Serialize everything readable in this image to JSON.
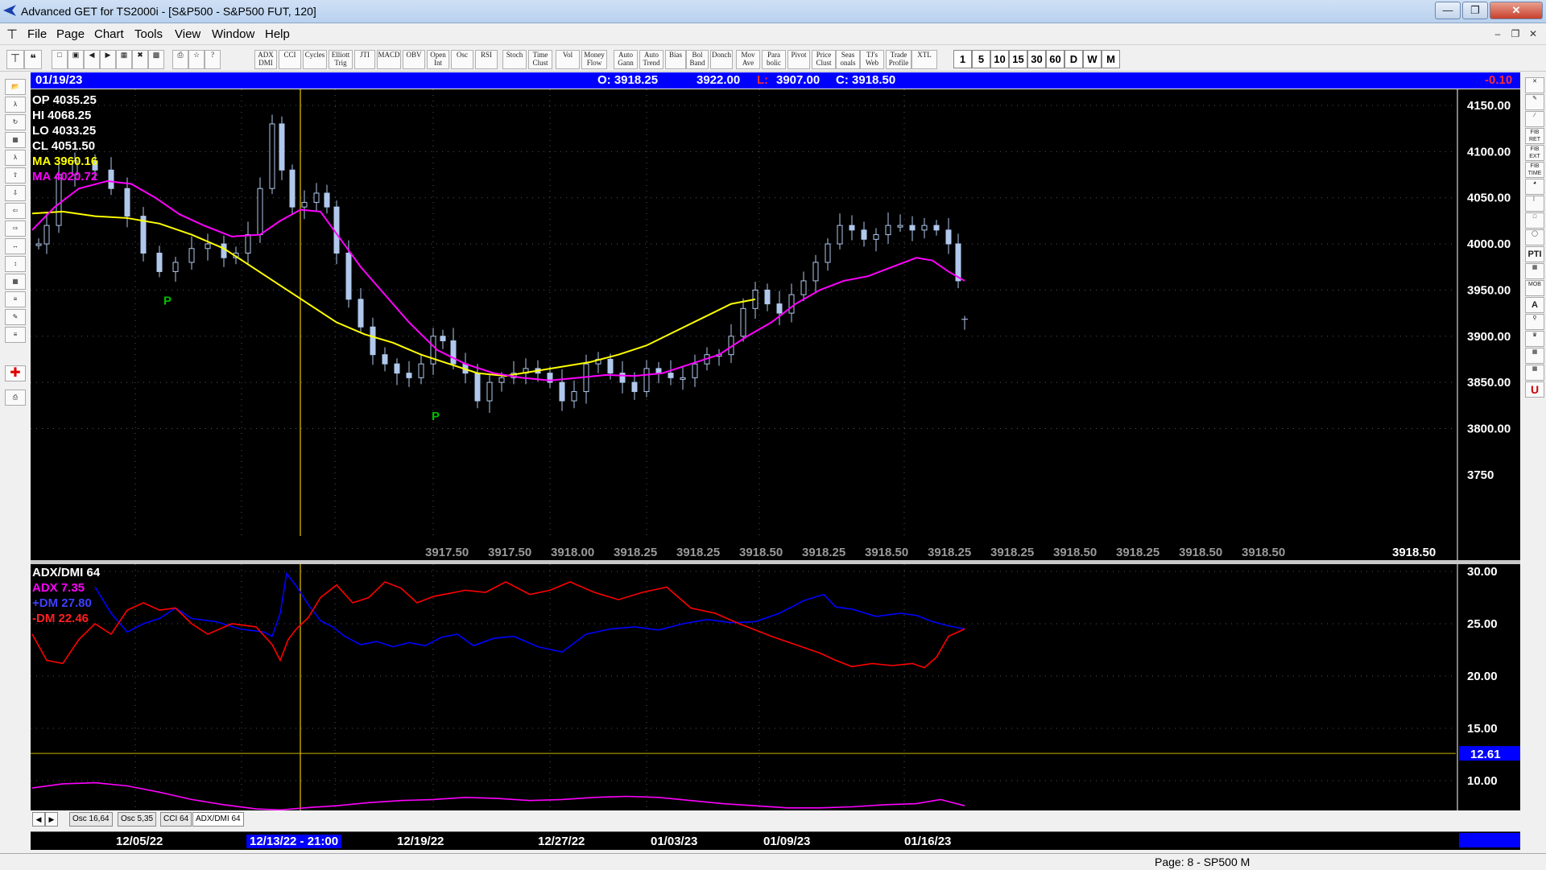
{
  "window": {
    "title": "Advanced GET for TS2000i - [S&P500 - S&P500 FUT, 120]"
  },
  "menu": [
    "File",
    "Page",
    "Chart",
    "Tools",
    "View",
    "Window",
    "Help"
  ],
  "toolbar": {
    "study_buttons": [
      "ADX DMI",
      "CCI",
      "Cycles",
      "Elliott Trig",
      "JTI",
      "MACD",
      "OBV",
      "Open Int",
      "Osc",
      "RSI",
      "Stoch",
      "Time Clust",
      "Vol",
      "Money Flow",
      "Auto Gann",
      "Auto Trend",
      "Bias",
      "Bol Band",
      "Donch",
      "Mov Ave",
      "Para bolic",
      "Pivot",
      "Price Clust",
      "Seas onals",
      "TJ's Web",
      "Trade Profile",
      "XTL"
    ],
    "timeframes": [
      "1",
      "5",
      "10",
      "15",
      "30",
      "60",
      "D",
      "W",
      "M"
    ]
  },
  "left_tools": [
    "open",
    "elliott",
    "reset",
    "study",
    "elliott",
    "up",
    "down",
    "left",
    "right",
    "zoom",
    "zoom",
    "grid",
    "lines",
    "gann",
    "fib",
    "cross",
    "print"
  ],
  "right_tools": [
    "x",
    "pen",
    "line",
    "fib ret",
    "fib ext",
    "fib time",
    "arc",
    "fan",
    "box",
    "ellipse",
    "pti",
    "grid",
    "mob",
    "A",
    "zoom",
    "paint",
    "grid",
    "grid",
    "U"
  ],
  "info_bar": {
    "date": "01/19/23",
    "open": "O: 3918.25",
    "high": "3922.00",
    "low_label": "L:",
    "low_value": "3907.00",
    "close": "C: 3918.50",
    "change": "-0.10"
  },
  "readout": {
    "op": "OP  4035.25",
    "hi": "HI   4068.25",
    "lo": "LO  4033.25",
    "cl": "CL  4051.50",
    "ma1": "MA  3960.16",
    "ma2": "MA  4020.72"
  },
  "colors": {
    "ma1": "#ffff00",
    "ma2": "#ff00ff",
    "candle": "#b0c8ec",
    "adx": "#ff00ff",
    "plus_dm": "#0000ff",
    "minus_dm": "#ff0000",
    "cursor": "#b8a000",
    "pivot": "#00c000",
    "level_line": "#c8b400"
  },
  "pivots": [
    "P",
    "P"
  ],
  "price_axis": [
    "4150.00",
    "4100.00",
    "4050.00",
    "4000.00",
    "3950.00",
    "3900.00",
    "3850.00",
    "3800.00",
    "3750"
  ],
  "bottom_prices": [
    "3917.50",
    "3917.50",
    "3918.00",
    "3918.25",
    "3918.25",
    "3918.50",
    "3918.25",
    "3918.50",
    "3918.25",
    "3918.25",
    "3918.50",
    "3918.25",
    "3918.50",
    "3918.50",
    "3918.50"
  ],
  "adx_panel": {
    "title": "ADX/DMI 64",
    "adx": "ADX 7.35",
    "plus_dm": "+DM 27.80",
    "minus_dm": "-DM  22.46",
    "axis": [
      "30.00",
      "25.00",
      "20.00",
      "15.00",
      "10.00"
    ],
    "level": "12.61"
  },
  "tabs": [
    "Osc 16,64",
    "Osc 5,35",
    "CCI 64",
    "ADX/DMI 64"
  ],
  "dates": [
    "12/05/22",
    "12/13/22 - 21:00",
    "12/19/22",
    "12/27/22",
    "01/03/23",
    "01/09/23",
    "01/16/23"
  ],
  "status": "Page: 8 - SP500 M"
}
